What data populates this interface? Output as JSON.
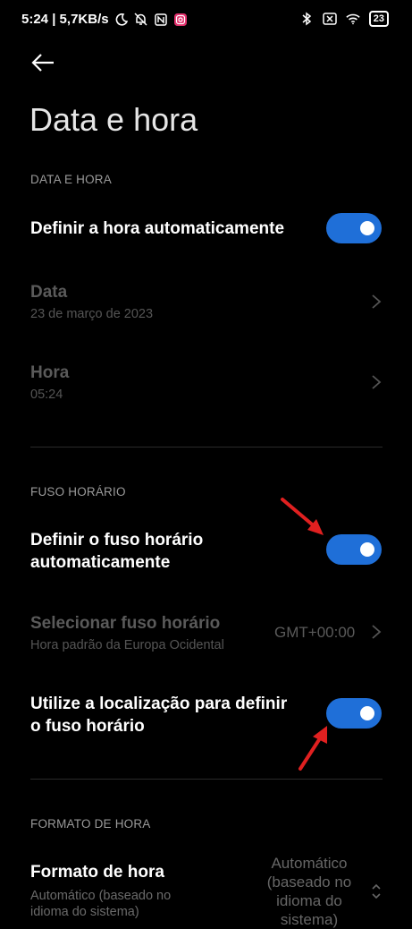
{
  "status_bar": {
    "time_speed": "5:24 | 5,7KB/s",
    "battery": "23",
    "icons": [
      "moon-icon",
      "bell-off-icon",
      "nfc-icon",
      "instagram-icon",
      "bluetooth-icon",
      "no-sim-icon",
      "wifi-icon",
      "battery-icon"
    ],
    "colors": {
      "instagram": "#e1306c"
    }
  },
  "page": {
    "title": "Data e hora"
  },
  "sections": {
    "date_time": {
      "header": "DATA E HORA"
    },
    "timezone": {
      "header": "FUSO HORÁRIO"
    },
    "time_format": {
      "header": "FORMATO DE HORA"
    }
  },
  "rows": {
    "auto_time": {
      "title": "Definir a hora automaticamente",
      "toggle_on": true
    },
    "date": {
      "title": "Data",
      "subtitle": "23 de março de 2023"
    },
    "time": {
      "title": "Hora",
      "subtitle": "05:24"
    },
    "auto_timezone": {
      "title_line1": "Definir o fuso horário",
      "title_line2": "automaticamente",
      "toggle_on": true
    },
    "select_timezone": {
      "title": "Selecionar fuso horário",
      "subtitle": "Hora padrão da Europa Ocidental",
      "value": "GMT+00:00"
    },
    "use_location": {
      "title_line1": "Utilize a localização para definir",
      "title_line2": "o fuso horário",
      "toggle_on": true
    },
    "time_format": {
      "title": "Formato de hora",
      "subtitle_line1": "Automático (baseado no",
      "subtitle_line2": "idioma do sistema)",
      "value_line1": "Automático",
      "value_line2": "(baseado no",
      "value_line3": "idioma do",
      "value_line4": "sistema)"
    }
  },
  "theme": {
    "toggle_color": "#1f6fd8",
    "arrow_color": "#e02020"
  }
}
